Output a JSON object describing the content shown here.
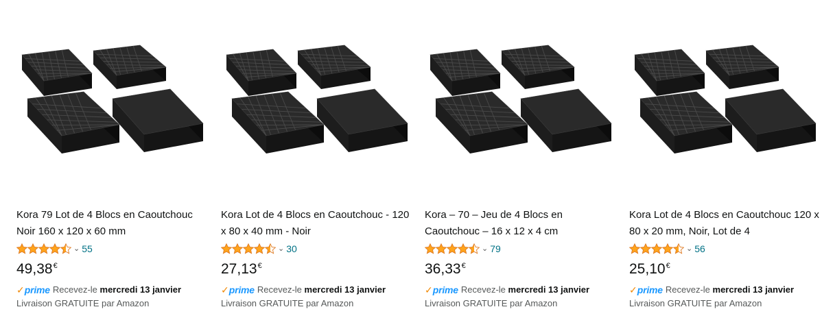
{
  "products": [
    {
      "title": "Kora 79 Lot de 4 Blocs en Caoutchouc Noir 160 x 120 x 60 mm",
      "rating": 4.5,
      "review_count": "55",
      "price_whole": "49,38",
      "currency": "€",
      "prime_label": "prime",
      "delivery_prefix": "Recevez-le",
      "delivery_date": "mercredi 13 janvier",
      "shipping": "Livraison GRATUITE par Amazon"
    },
    {
      "title": "Kora Lot de 4 Blocs en Caoutchouc - 120 x 80 x 40 mm - Noir",
      "rating": 4.5,
      "review_count": "30",
      "price_whole": "27,13",
      "currency": "€",
      "prime_label": "prime",
      "delivery_prefix": "Recevez-le",
      "delivery_date": "mercredi 13 janvier",
      "shipping": "Livraison GRATUITE par Amazon"
    },
    {
      "title": "Kora – 70 – Jeu de 4 Blocs en Caoutchouc – 16 x 12 x 4 cm",
      "rating": 4.5,
      "review_count": "79",
      "price_whole": "36,33",
      "currency": "€",
      "prime_label": "prime",
      "delivery_prefix": "Recevez-le",
      "delivery_date": "mercredi 13 janvier",
      "shipping": "Livraison GRATUITE par Amazon"
    },
    {
      "title": "Kora Lot de 4 Blocs en Caoutchouc 120 x 80 x 20 mm, Noir, Lot de 4",
      "rating": 4.5,
      "review_count": "56",
      "price_whole": "25,10",
      "currency": "€",
      "prime_label": "prime",
      "delivery_prefix": "Recevez-le",
      "delivery_date": "mercredi 13 janvier",
      "shipping": "Livraison GRATUITE par Amazon"
    }
  ],
  "icons": {
    "product_image": "rubber-blocks-image",
    "star": "star-icon",
    "chevron": "chevron-down-icon",
    "prime_check": "prime-check-icon"
  },
  "colors": {
    "star": "#ffa41c",
    "link": "#007185",
    "prime_blue": "#1a98ff",
    "prime_check": "#f08804",
    "text": "#0f1111",
    "muted": "#565959"
  }
}
